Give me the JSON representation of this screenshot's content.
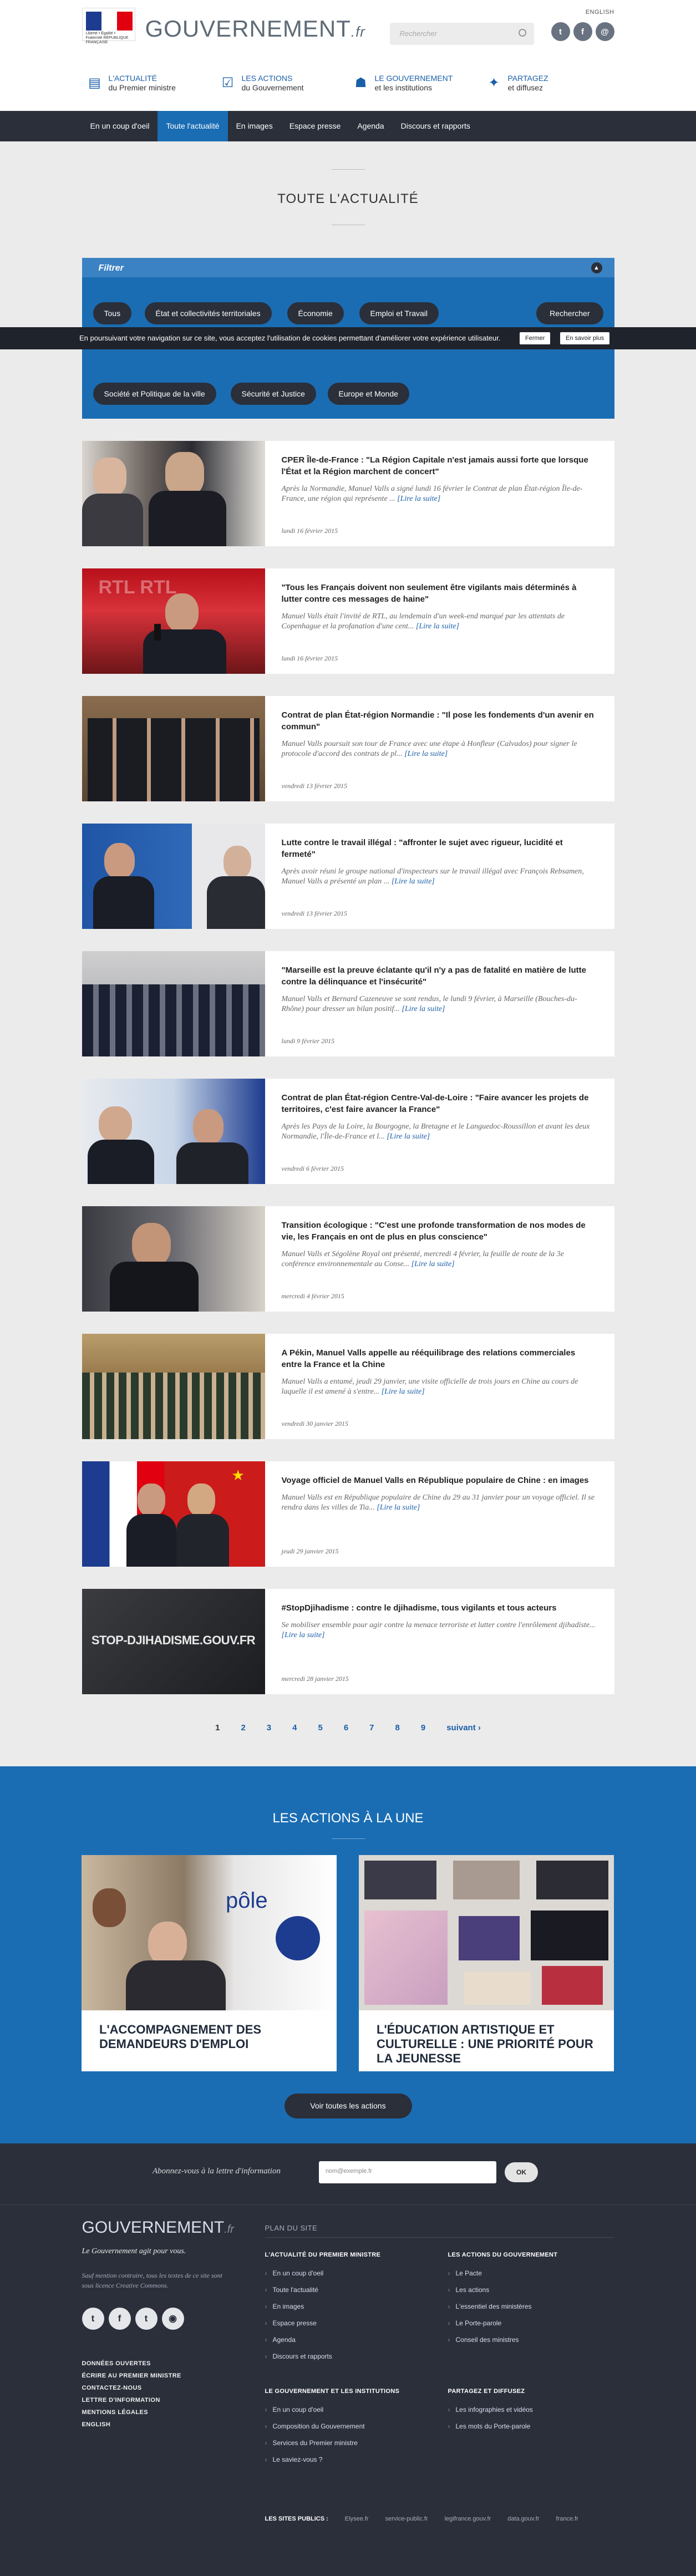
{
  "header": {
    "logo_label": "Liberté • Égalité • Fraternité RÉPUBLIQUE FRANÇAISE",
    "brand": "GOUVERNEMENT",
    "brand_suffix": ".fr",
    "english": "ENGLISH",
    "search_placeholder": "Rechercher",
    "social": [
      "t",
      "f",
      "@"
    ],
    "nav": [
      {
        "line1": "L'ACTUALITÉ",
        "line2": "du Premier ministre"
      },
      {
        "line1": "LES ACTIONS",
        "line2": "du Gouvernement"
      },
      {
        "line1": "LE GOUVERNEMENT",
        "line2": "et les institutions"
      },
      {
        "line1": "PARTAGEZ",
        "line2": "et diffusez"
      }
    ]
  },
  "subnav": [
    "En un coup d'oeil",
    "Toute l'actualité",
    "En images",
    "Espace presse",
    "Agenda",
    "Discours et rapports"
  ],
  "page_title": "TOUTE L'ACTUALITÉ",
  "filter": {
    "title": "Filtrer",
    "tags": [
      "Tous",
      "État et collectivités territoriales",
      "Économie",
      "Emploi et Travail",
      "Société et Politique de la ville",
      "Sécurité et Justice",
      "Europe et Monde"
    ],
    "button": "Rechercher"
  },
  "cookie": {
    "text": "En poursuivant votre navigation sur ce site, vous acceptez l'utilisation de cookies permettant d'améliorer votre expérience utilisateur.",
    "close": "Fermer",
    "more": "En savoir plus"
  },
  "articles": [
    {
      "title": "CPER Île-de-France : \"La Région Capitale n'est jamais aussi forte que lorsque l'État et la Région marchent de concert\"",
      "excerpt": "Après la Normandie, Manuel Valls a signé lundi 16 février le Contrat de plan État-région Île-de-France, une région qui représente ...",
      "more": "[Lire la suite]",
      "date": "lundi 16 février 2015"
    },
    {
      "title": "\"Tous les Français doivent non seulement être vigilants mais déterminés à lutter contre ces messages de haine\"",
      "excerpt": "Manuel Valls était l'invité de RTL, au lendemain d'un week-end marqué par les attentats de Copenhague et la profanation d'une cent...",
      "more": "[Lire la suite]",
      "date": "lundi 16 février 2015"
    },
    {
      "title": "Contrat de plan État-région Normandie : \"Il pose les fondements d'un avenir en commun\"",
      "excerpt": "Manuel Valls poursuit son tour de France avec une étape à Honfleur (Calvados) pour signer le protocole d'accord des contrats de pl...",
      "more": "[Lire la suite]",
      "date": "vendredi 13 février 2015"
    },
    {
      "title": "Lutte contre le travail illégal : \"affronter le sujet avec rigueur, lucidité et fermeté\"",
      "excerpt": "Après avoir réuni le groupe national d'inspecteurs sur le travail illégal avec François Rebsamen, Manuel Valls a présenté un plan ...",
      "more": "[Lire la suite]",
      "date": "vendredi 13 février 2015"
    },
    {
      "title": "\"Marseille est la preuve éclatante qu'il n'y a pas de fatalité en matière de lutte contre la délinquance et l'insécurité\"",
      "excerpt": "Manuel Valls et Bernard Cazeneuve se sont rendus, le lundi 9 février, à Marseille (Bouches-du-Rhône) pour dresser un bilan positif...",
      "more": "[Lire la suite]",
      "date": "lundi 9 février 2015"
    },
    {
      "title": "Contrat de plan État-région Centre-Val-de-Loire : \"Faire avancer les projets de territoires, c'est faire avancer la France\"",
      "excerpt": "Après les Pays de la Loire, la Bourgogne, la Bretagne et le Languedoc-Roussillon et avant les deux Normandie, l'Île-de-France et l...",
      "more": "[Lire la suite]",
      "date": "vendredi 6 février 2015"
    },
    {
      "title": "Transition écologique : \"C'est une profonde transformation de nos modes de vie, les Français en ont de plus en plus conscience\"",
      "excerpt": "Manuel Valls et Ségolène Royal ont présenté, mercredi 4 février, la feuille de route de la 3e conférence environnementale au Conse...",
      "more": "[Lire la suite]",
      "date": "mercredi 4 février 2015"
    },
    {
      "title": "A Pékin, Manuel Valls appelle au rééquilibrage des relations commerciales entre la France et la Chine",
      "excerpt": "Manuel Valls a entamé, jeudi 29 janvier, une visite officielle de trois jours en Chine au cours de laquelle il est amené à s'entre...",
      "more": "[Lire la suite]",
      "date": "vendredi 30 janvier 2015"
    },
    {
      "title": "Voyage officiel de Manuel Valls en République populaire de Chine : en images",
      "excerpt": "Manuel Valls est en République populaire de Chine du 29 au 31 janvier pour un voyage officiel. Il se rendra dans les villes de Tia...",
      "more": "[Lire la suite]",
      "date": "jeudi 29 janvier 2015"
    },
    {
      "title": "#StopDjihadisme : contre le djihadisme, tous vigilants et tous acteurs",
      "excerpt": "Se mobiliser ensemble pour agir contre la menace terroriste et lutter contre l'enrôlement djihadiste...",
      "more": "[Lire la suite]",
      "date": "mercredi 28 janvier 2015",
      "image_text": "STOP-DJIHADISME.GOUV.FR"
    }
  ],
  "pager": [
    "1",
    "2",
    "3",
    "4",
    "5",
    "6",
    "7",
    "8",
    "9",
    "suivant ›"
  ],
  "actions": {
    "title": "LES ACTIONS À LA UNE",
    "cards": [
      {
        "title": "L'ACCOMPAGNEMENT DES DEMANDEURS D'EMPLOI",
        "image_text": "pôle"
      },
      {
        "title": "L'ÉDUCATION ARTISTIQUE ET CULTURELLE : UNE PRIORITÉ POUR LA JEUNESSE"
      }
    ],
    "button": "Voir toutes les actions"
  },
  "newsletter": {
    "label": "Abonnez-vous à la lettre d'information",
    "placeholder": "nom@exemple.fr",
    "ok": "OK"
  },
  "footer": {
    "brand": "GOUVERNEMENT",
    "brand_suffix": ".fr",
    "slogan": "Le Gouvernement agit pour vous.",
    "cc": "Sauf mention contraire, tous les textes de ce site sont sous licence Creative Commons.",
    "social": [
      "t",
      "f",
      "t",
      "◉"
    ],
    "links": [
      "DONNÉES OUVERTES",
      "ÉCRIRE AU PREMIER MINISTRE",
      "CONTACTEZ-NOUS",
      "LETTRE D'INFORMATION",
      "MENTIONS LÉGALES",
      "ENGLISH"
    ],
    "plan_title": "PLAN DU SITE",
    "cols": [
      {
        "title": "L'ACTUALITÉ DU PREMIER MINISTRE",
        "items": [
          "En un coup d'oeil",
          "Toute l'actualité",
          "En images",
          "Espace presse",
          "Agenda",
          "Discours et rapports"
        ]
      },
      {
        "title": "LES ACTIONS DU GOUVERNEMENT",
        "items": [
          "Le Pacte",
          "Les actions",
          "L'essentiel des ministères",
          "Le Porte-parole",
          "Conseil des ministres"
        ]
      },
      {
        "title": "LE GOUVERNEMENT ET LES INSTITUTIONS",
        "items": [
          "En un coup d'oeil",
          "Composition du Gouvernement",
          "Services du Premier ministre",
          "Le saviez-vous ?"
        ]
      },
      {
        "title": "PARTAGEZ ET DIFFUSEZ",
        "items": [
          "Les infographies et vidéos",
          "Les mots du Porte-parole"
        ]
      }
    ],
    "sites_label": "LES SITES PUBLICS :",
    "sites": [
      "Elysee.fr",
      "service-public.fr",
      "legifrance.gouv.fr",
      "data.gouv.fr",
      "france.fr"
    ]
  },
  "colors": {
    "brand_blue": "#1a6db3",
    "dark": "#2a2f3a",
    "link": "#1a5fa8"
  }
}
